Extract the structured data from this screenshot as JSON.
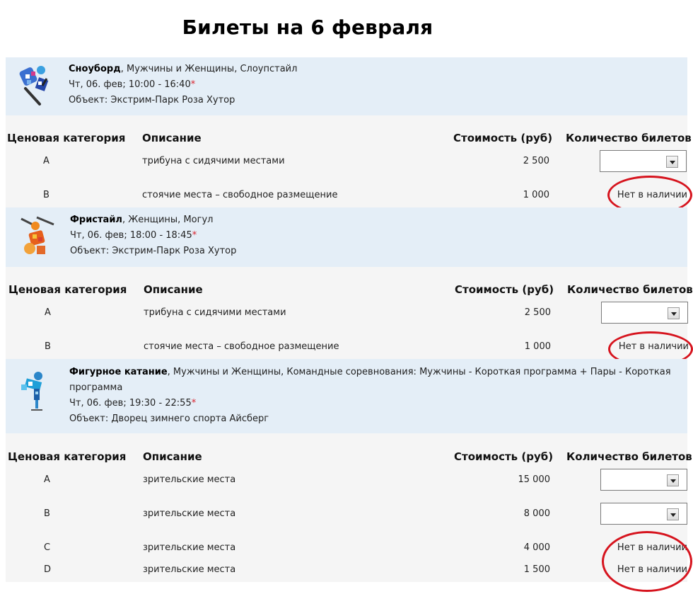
{
  "page": {
    "title": "Билеты на 6 февраля"
  },
  "columns": {
    "category": "Ценовая категория",
    "description": "Описание",
    "price": "Стоимость (руб)",
    "quantity": "Количество билетов"
  },
  "events": [
    {
      "sport": "Сноуборд",
      "details": ", Мужчины и Женщины, Слоупстайл",
      "time": "Чт, 06. фев; 10:00 - 16:40",
      "required_mark": "*",
      "venue": "Объект: Экстрим-Парк Роза Хутор",
      "icon": "snowboard-icon",
      "tickets": [
        {
          "category": "A",
          "description": "трибуна с сидячими местами",
          "price": "2 500",
          "available": true,
          "quantity": ""
        },
        {
          "category": "B",
          "description": "стоячие места – свободное размещение",
          "price": "1 000",
          "available": false,
          "status": "Нет в наличии"
        }
      ]
    },
    {
      "sport": "Фристайл",
      "details": ", Женщины, Могул",
      "time": "Чт, 06. фев; 18:00 - 18:45",
      "required_mark": "*",
      "venue": "Объект: Экстрим-Парк Роза Хутор",
      "icon": "freestyle-icon",
      "tickets": [
        {
          "category": "A",
          "description": "трибуна с сидячими местами",
          "price": "2 500",
          "available": true,
          "quantity": ""
        },
        {
          "category": "B",
          "description": "стоячие места – свободное размещение",
          "price": "1 000",
          "available": false,
          "status": "Нет в наличии"
        }
      ]
    },
    {
      "sport": "Фигурное катание",
      "details": ", Мужчины и Женщины, Командные соревнования: Мужчины - Короткая программа + Пары - Короткая программа",
      "time": "Чт, 06. фев; 19:30 - 22:55",
      "required_mark": "*",
      "venue": "Объект: Дворец зимнего спорта Айсберг",
      "icon": "figure-skating-icon",
      "tickets": [
        {
          "category": "A",
          "description": "зрительские места",
          "price": "15 000",
          "available": true,
          "quantity": ""
        },
        {
          "category": "B",
          "description": "зрительские места",
          "price": "8 000",
          "available": true,
          "quantity": ""
        },
        {
          "category": "C",
          "description": "зрительские места",
          "price": "4 000",
          "available": false,
          "status": "Нет в наличии"
        },
        {
          "category": "D",
          "description": "зрительские места",
          "price": "1 500",
          "available": false,
          "status": "Нет в наличии"
        }
      ]
    }
  ],
  "colors": {
    "event_header_bg": "#e4eef7",
    "ticket_bg": "#f5f5f5",
    "annotation_circle": "#d6141e",
    "required_mark": "#d9232d"
  }
}
